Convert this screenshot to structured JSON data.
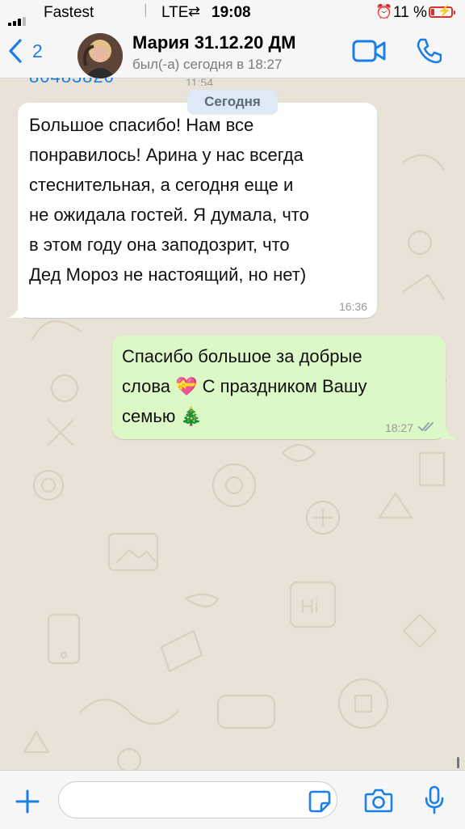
{
  "status_bar": {
    "carrier": "Fastest",
    "network": "LTE",
    "time": "19:08",
    "battery": "11 %",
    "battery_level": 0.11,
    "accent_battery": "#d2332f"
  },
  "header": {
    "back_count": "2",
    "contact_name": "Мария 31.12.20 ДМ",
    "last_seen": "был(-а) сегодня в 18:27",
    "accent": "#1a7fe6"
  },
  "chat": {
    "date_separator": "Сегодня",
    "prev_time": "11:54",
    "messages": [
      {
        "direction": "incoming",
        "lines": [
          "Большое спасибо!  Нам все",
          "понравилось! Арина у нас всегда",
          "стеснительная, а сегодня еще и",
          "не ожидала гостей. Я думала, что",
          "в этом году она заподозрит, что",
          "Дед Мороз не настоящий, но нет)"
        ],
        "time": "16:36"
      },
      {
        "direction": "outgoing",
        "lines": [
          "Спасибо большое за добрые",
          "слова 💝 С праздником Вашу",
          "семью 🎄"
        ],
        "time": "18:27",
        "status": "read"
      }
    ]
  },
  "input_bar": {
    "placeholder": ""
  }
}
